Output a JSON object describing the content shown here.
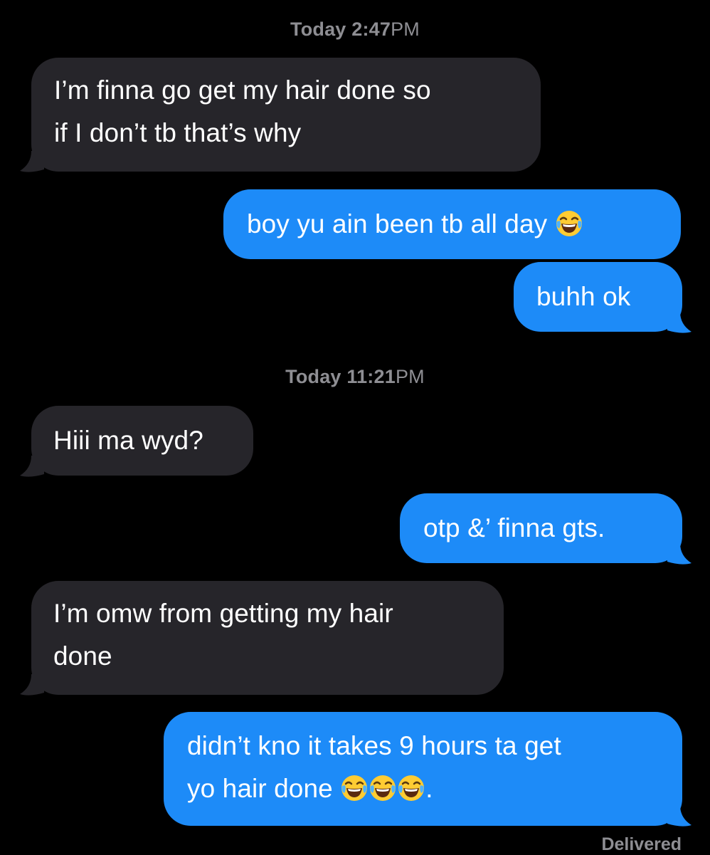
{
  "thread": {
    "timestamps": [
      {
        "day": "Today",
        "time": "2:47",
        "ampm": "PM"
      },
      {
        "day": "Today",
        "time": "11:21",
        "ampm": "PM"
      }
    ],
    "messages": [
      {
        "direction": "incoming",
        "lines": [
          "I’m finna go get my hair done so",
          "if I don’t tb that’s why"
        ]
      },
      {
        "direction": "outgoing",
        "text": "boy yu ain been tb all day",
        "emoji": "face-with-tears-of-joy"
      },
      {
        "direction": "outgoing",
        "text": "buhh ok"
      },
      {
        "direction": "incoming",
        "text": "Hiii ma wyd?"
      },
      {
        "direction": "outgoing",
        "text": "otp &’ finna gts."
      },
      {
        "direction": "incoming",
        "lines": [
          "I’m omw from getting my hair",
          "done"
        ]
      },
      {
        "direction": "outgoing",
        "lines": [
          "didn’t kno it takes 9 hours ta get",
          "yo hair done"
        ],
        "trailing_emojis": [
          "face-with-tears-of-joy",
          "face-with-tears-of-joy",
          "face-with-tears-of-joy"
        ],
        "trailing_text": "."
      }
    ],
    "status": "Delivered"
  },
  "colors": {
    "background": "#000000",
    "incoming_bubble": "#26252a",
    "outgoing_bubble": "#1d8bf8",
    "text": "#ffffff",
    "meta_text": "#8e8e93",
    "emoji_face": "#ffcc33"
  }
}
